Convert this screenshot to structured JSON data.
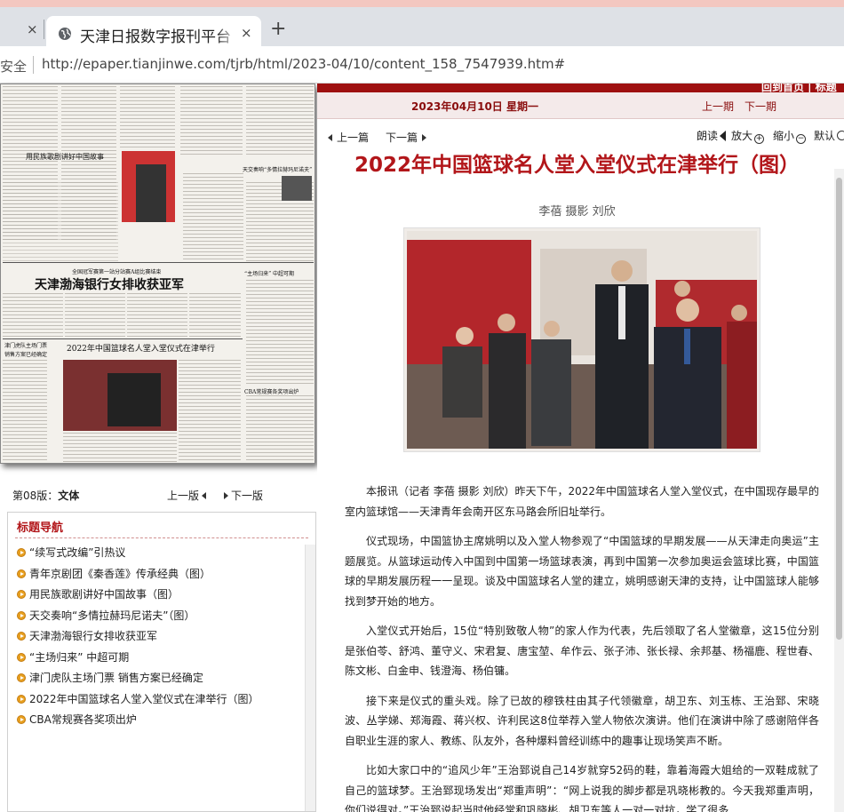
{
  "browser": {
    "tab_title": "天津日报数字报刊平台",
    "close_symbol": "×",
    "new_tab_symbol": "+",
    "security_label": "安全",
    "url": "http://epaper.tianjinwe.com/tjrb/html/2023-04/10/content_158_7547939.htm#"
  },
  "newspaper_thumb": {
    "headlines": [
      "用民族歌剧讲好中国故事",
      "天交奏响“多情拉赫玛尼诺夫”",
      "全国冠军赛第一站分站赛A组比赛结束",
      "天津渤海银行女排收获亚军",
      "“主场归来” 中超可期",
      "津门虎队主场门票",
      "销售方案已经确定",
      "2022年中国篮球名人堂入堂仪式在津举行",
      "CBA常规赛各奖项出炉"
    ]
  },
  "page_nav": {
    "label_prefix": "第08版：",
    "section": "文体",
    "prev": "上一版",
    "next": "下一版"
  },
  "headline_nav": {
    "title": "标题导航",
    "items": [
      "“续写式改编”引热议",
      "青年京剧团《秦香莲》传承经典（图）",
      "用民族歌剧讲好中国故事（图）",
      "天交奏响“多情拉赫玛尼诺夫”（图）",
      "天津渤海银行女排收获亚军",
      "“主场归来” 中超可期",
      "津门虎队主场门票 销售方案已经确定",
      "2022年中国篮球名人堂入堂仪式在津举行（图）",
      "CBA常规赛各奖项出炉"
    ]
  },
  "header": {
    "home": "回到首页 | 标题",
    "date": "2023年04月10日 星期一",
    "prev_period": "上一期",
    "next_period": "下一期"
  },
  "toolbar": {
    "prev_article": "上一篇",
    "next_article": "下一篇",
    "read": "朗读",
    "zoom_in": "放大",
    "zoom_out": "缩小",
    "default": "默认"
  },
  "article": {
    "title": "2022年中国篮球名人堂入堂仪式在津举行（图）",
    "byline": "李蓓 摄影 刘欣",
    "paragraphs": [
      "本报讯（记者 李蓓 摄影 刘欣）昨天下午，2022年中国篮球名人堂入堂仪式，在中国现存最早的室内篮球馆——天津青年会南开区东马路会所旧址举行。",
      "仪式现场，中国篮协主席姚明以及入堂人物参观了“中国篮球的早期发展——从天津走向奥运”主题展览。从篮球运动传入中国到中国第一场篮球表演，再到中国第一次参加奥运会篮球比赛，中国篮球的早期发展历程一一呈现。谈及中国篮球名人堂的建立，姚明感谢天津的支持，让中国篮球人能够找到梦开始的地方。",
      "入堂仪式开始后，15位“特别致敬人物”的家人作为代表，先后领取了名人堂徽章，这15位分别是张伯苓、舒鸿、董守义、宋君复、唐宝堃、牟作云、张子沛、张长禄、余邦基、杨福鹿、程世春、陈文彬、白金申、钱澄海、杨伯镛。",
      "接下来是仪式的重头戏。除了已故的穆铁柱由其子代领徽章，胡卫东、刘玉栋、王治郅、宋晓波、丛学娣、郑海霞、蒋兴权、许利民这8位举荐入堂人物依次演讲。他们在演讲中除了感谢陪伴各自职业生涯的家人、教练、队友外，各种爆料曾经训练中的趣事让现场笑声不断。",
      "比如大家口中的“追风少年”王治郅说自己14岁就穿52码的鞋，靠着海霞大姐给的一双鞋成就了自己的篮球梦。王治郅现场发出“郑重声明”：“网上说我的脚步都是巩晓彬教的。今天我郑重声明，你们说得对。”王治郅说起当时他经常和巩晓彬、胡卫东等人一对一对抗，学了很多"
    ]
  }
}
